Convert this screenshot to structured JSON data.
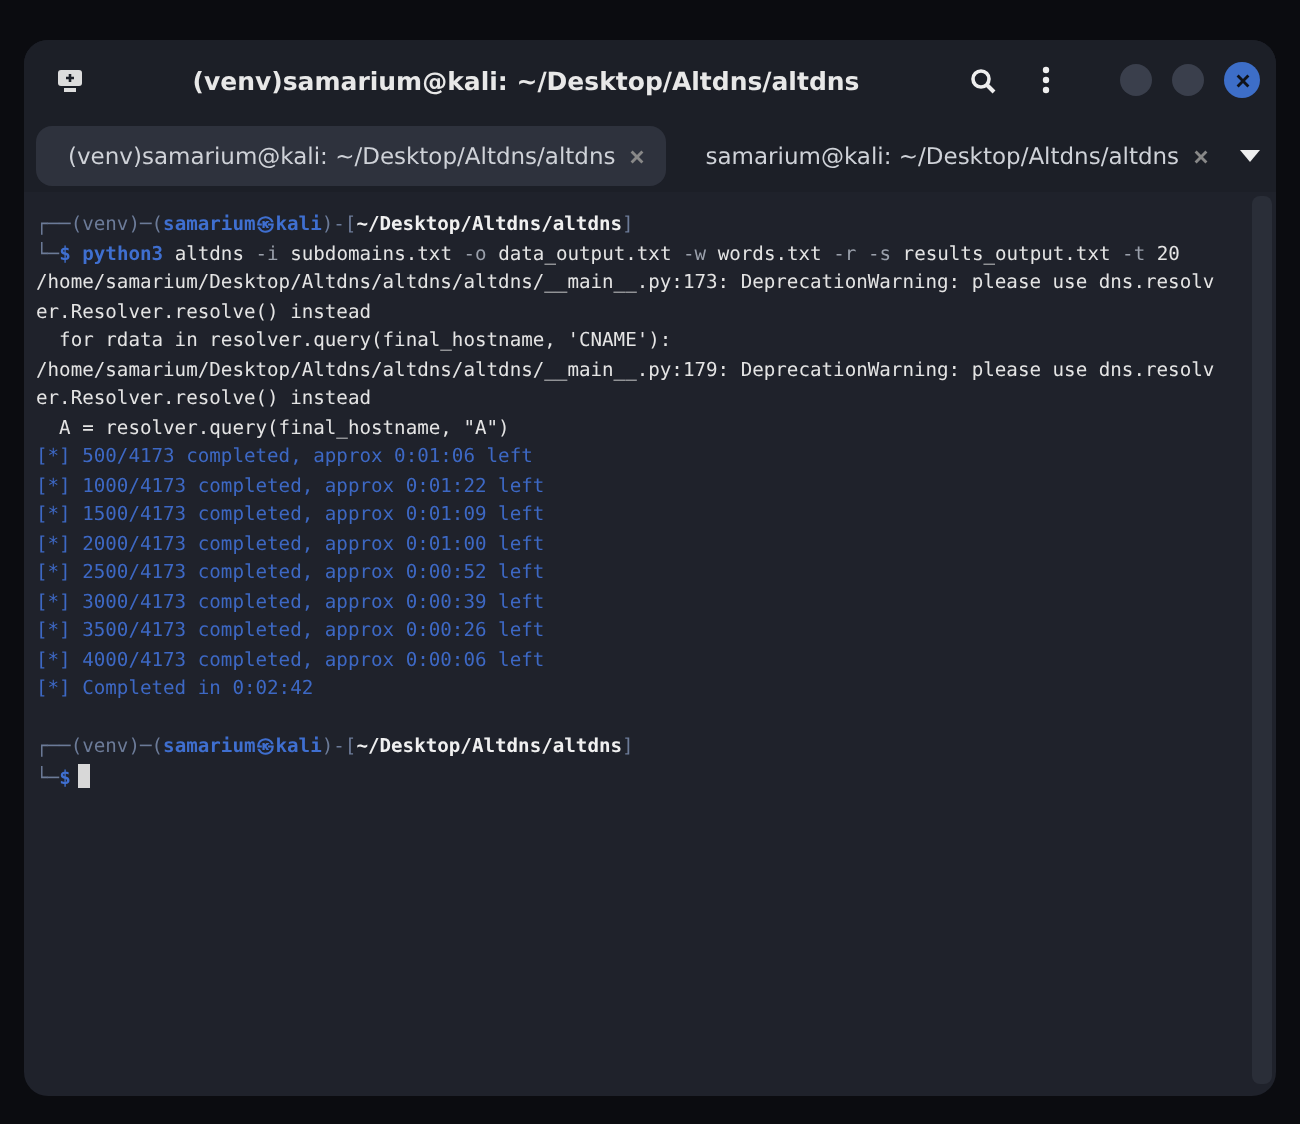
{
  "window": {
    "title": "(venv)samarium@kali: ~/Desktop/Altdns/altdns"
  },
  "tabs": [
    {
      "label": "(venv)samarium@kali: ~/Desktop/Altdns/altdns",
      "selected": true
    },
    {
      "label": "samarium@kali: ~/Desktop/Altdns/altdns",
      "selected": false
    }
  ],
  "terminal": {
    "lines": [
      {
        "segments": [
          {
            "kind": "frame",
            "text": "┌──(venv)─("
          },
          {
            "kind": "user",
            "text": "samarium㉿kali"
          },
          {
            "kind": "frame",
            "text": ")-["
          },
          {
            "kind": "path",
            "text": "~/Desktop/Altdns/altdns"
          },
          {
            "kind": "frame",
            "text": "]"
          }
        ]
      },
      {
        "segments": [
          {
            "kind": "frame",
            "text": "└─"
          },
          {
            "kind": "user",
            "text": "$ python3"
          },
          {
            "kind": "text",
            "text": " altdns "
          },
          {
            "kind": "flag",
            "text": "-i"
          },
          {
            "kind": "text",
            "text": " subdomains.txt "
          },
          {
            "kind": "flag",
            "text": "-o"
          },
          {
            "kind": "text",
            "text": " data_output.txt "
          },
          {
            "kind": "flag",
            "text": "-w"
          },
          {
            "kind": "text",
            "text": " words.txt "
          },
          {
            "kind": "flag",
            "text": "-r -s"
          },
          {
            "kind": "text",
            "text": " results_output.txt "
          },
          {
            "kind": "flag",
            "text": "-t"
          },
          {
            "kind": "text",
            "text": " 20"
          }
        ]
      },
      {
        "segments": [
          {
            "kind": "text",
            "text": "/home/samarium/Desktop/Altdns/altdns/altdns/__main__.py:173: DeprecationWarning: please use dns.resolv"
          }
        ]
      },
      {
        "segments": [
          {
            "kind": "text",
            "text": "er.Resolver.resolve() instead"
          }
        ]
      },
      {
        "segments": [
          {
            "kind": "text",
            "text": "  for rdata in resolver.query(final_hostname, 'CNAME'):"
          }
        ]
      },
      {
        "segments": [
          {
            "kind": "text",
            "text": "/home/samarium/Desktop/Altdns/altdns/altdns/__main__.py:179: DeprecationWarning: please use dns.resolv"
          }
        ]
      },
      {
        "segments": [
          {
            "kind": "text",
            "text": "er.Resolver.resolve() instead"
          }
        ]
      },
      {
        "segments": [
          {
            "kind": "text",
            "text": "  A = resolver.query(final_hostname, \"A\")"
          }
        ]
      },
      {
        "segments": [
          {
            "kind": "info",
            "text": "[*] 500/4173 completed, approx 0:01:06 left"
          }
        ]
      },
      {
        "segments": [
          {
            "kind": "info",
            "text": "[*] 1000/4173 completed, approx 0:01:22 left"
          }
        ]
      },
      {
        "segments": [
          {
            "kind": "info",
            "text": "[*] 1500/4173 completed, approx 0:01:09 left"
          }
        ]
      },
      {
        "segments": [
          {
            "kind": "info",
            "text": "[*] 2000/4173 completed, approx 0:01:00 left"
          }
        ]
      },
      {
        "segments": [
          {
            "kind": "info",
            "text": "[*] 2500/4173 completed, approx 0:00:52 left"
          }
        ]
      },
      {
        "segments": [
          {
            "kind": "info",
            "text": "[*] 3000/4173 completed, approx 0:00:39 left"
          }
        ]
      },
      {
        "segments": [
          {
            "kind": "info",
            "text": "[*] 3500/4173 completed, approx 0:00:26 left"
          }
        ]
      },
      {
        "segments": [
          {
            "kind": "info",
            "text": "[*] 4000/4173 completed, approx 0:00:06 left"
          }
        ]
      },
      {
        "segments": [
          {
            "kind": "info",
            "text": "[*] Completed in 0:02:42"
          }
        ]
      },
      {
        "blank_before": true,
        "segments": [
          {
            "kind": "frame",
            "text": "┌──(venv)─("
          },
          {
            "kind": "user",
            "text": "samarium㉿kali"
          },
          {
            "kind": "frame",
            "text": ")-["
          },
          {
            "kind": "path",
            "text": "~/Desktop/Altdns/altdns"
          },
          {
            "kind": "frame",
            "text": "]"
          }
        ]
      },
      {
        "segments": [
          {
            "kind": "frame",
            "text": "└─"
          },
          {
            "kind": "user",
            "text": "$"
          }
        ],
        "cursor": true
      }
    ]
  }
}
